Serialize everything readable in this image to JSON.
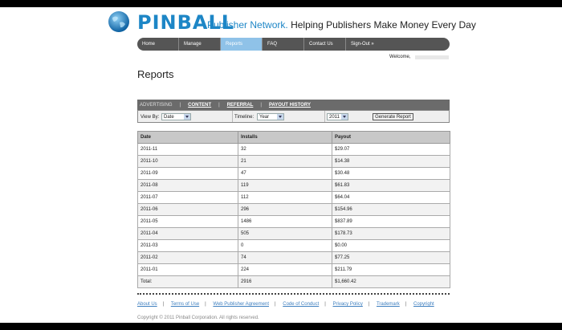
{
  "brand": {
    "name": "PINBALL",
    "network": "Publisher Network.",
    "slogan": "Helping Publishers Make Money Every Day"
  },
  "nav": {
    "items": [
      "Home",
      "Manage",
      "Reports",
      "FAQ",
      "Contact Us",
      "Sign-Out »"
    ],
    "active": "Reports"
  },
  "welcome": "Welcome,",
  "page_title": "Reports",
  "report_tabs": [
    {
      "label": "ADVERTISING",
      "active": true
    },
    {
      "label": "CONTENT",
      "active": false
    },
    {
      "label": "REFERRAL",
      "active": false
    },
    {
      "label": "PAYOUT HISTORY",
      "active": false
    }
  ],
  "filters": {
    "view_by_label": "View By:",
    "view_by_value": "Date",
    "timeline_label": "Timeline:",
    "timeline_value": "Year",
    "year_value": "2011",
    "generate_label": "Generate Report"
  },
  "table": {
    "headers": [
      "Date",
      "Installs",
      "Payout"
    ],
    "rows": [
      [
        "2011-11",
        "32",
        "$29.07"
      ],
      [
        "2011-10",
        "21",
        "$14.38"
      ],
      [
        "2011-09",
        "47",
        "$30.48"
      ],
      [
        "2011-08",
        "119",
        "$61.83"
      ],
      [
        "2011-07",
        "112",
        "$64.04"
      ],
      [
        "2011-06",
        "296",
        "$154.96"
      ],
      [
        "2011-05",
        "1486",
        "$837.89"
      ],
      [
        "2011-04",
        "505",
        "$178.73"
      ],
      [
        "2011-03",
        "0",
        "$0.00"
      ],
      [
        "2011-02",
        "74",
        "$77.25"
      ],
      [
        "2011-01",
        "224",
        "$211.79"
      ]
    ],
    "total": [
      "Total:",
      "2916",
      "$1,660.42"
    ]
  },
  "footer": {
    "links": [
      "About Us",
      "Terms of Use",
      "Web Publisher Agreement",
      "Code of Conduct",
      "Privacy Policy",
      "Trademark",
      "Copyright"
    ],
    "copyright": "Copyright © 2011 Pinball Corporation. All rights reserved."
  },
  "colors": {
    "brand_blue": "#1d86c6",
    "nav_bg": "#555555",
    "nav_active": "#8fc2e8",
    "link": "#3e7fbf"
  }
}
